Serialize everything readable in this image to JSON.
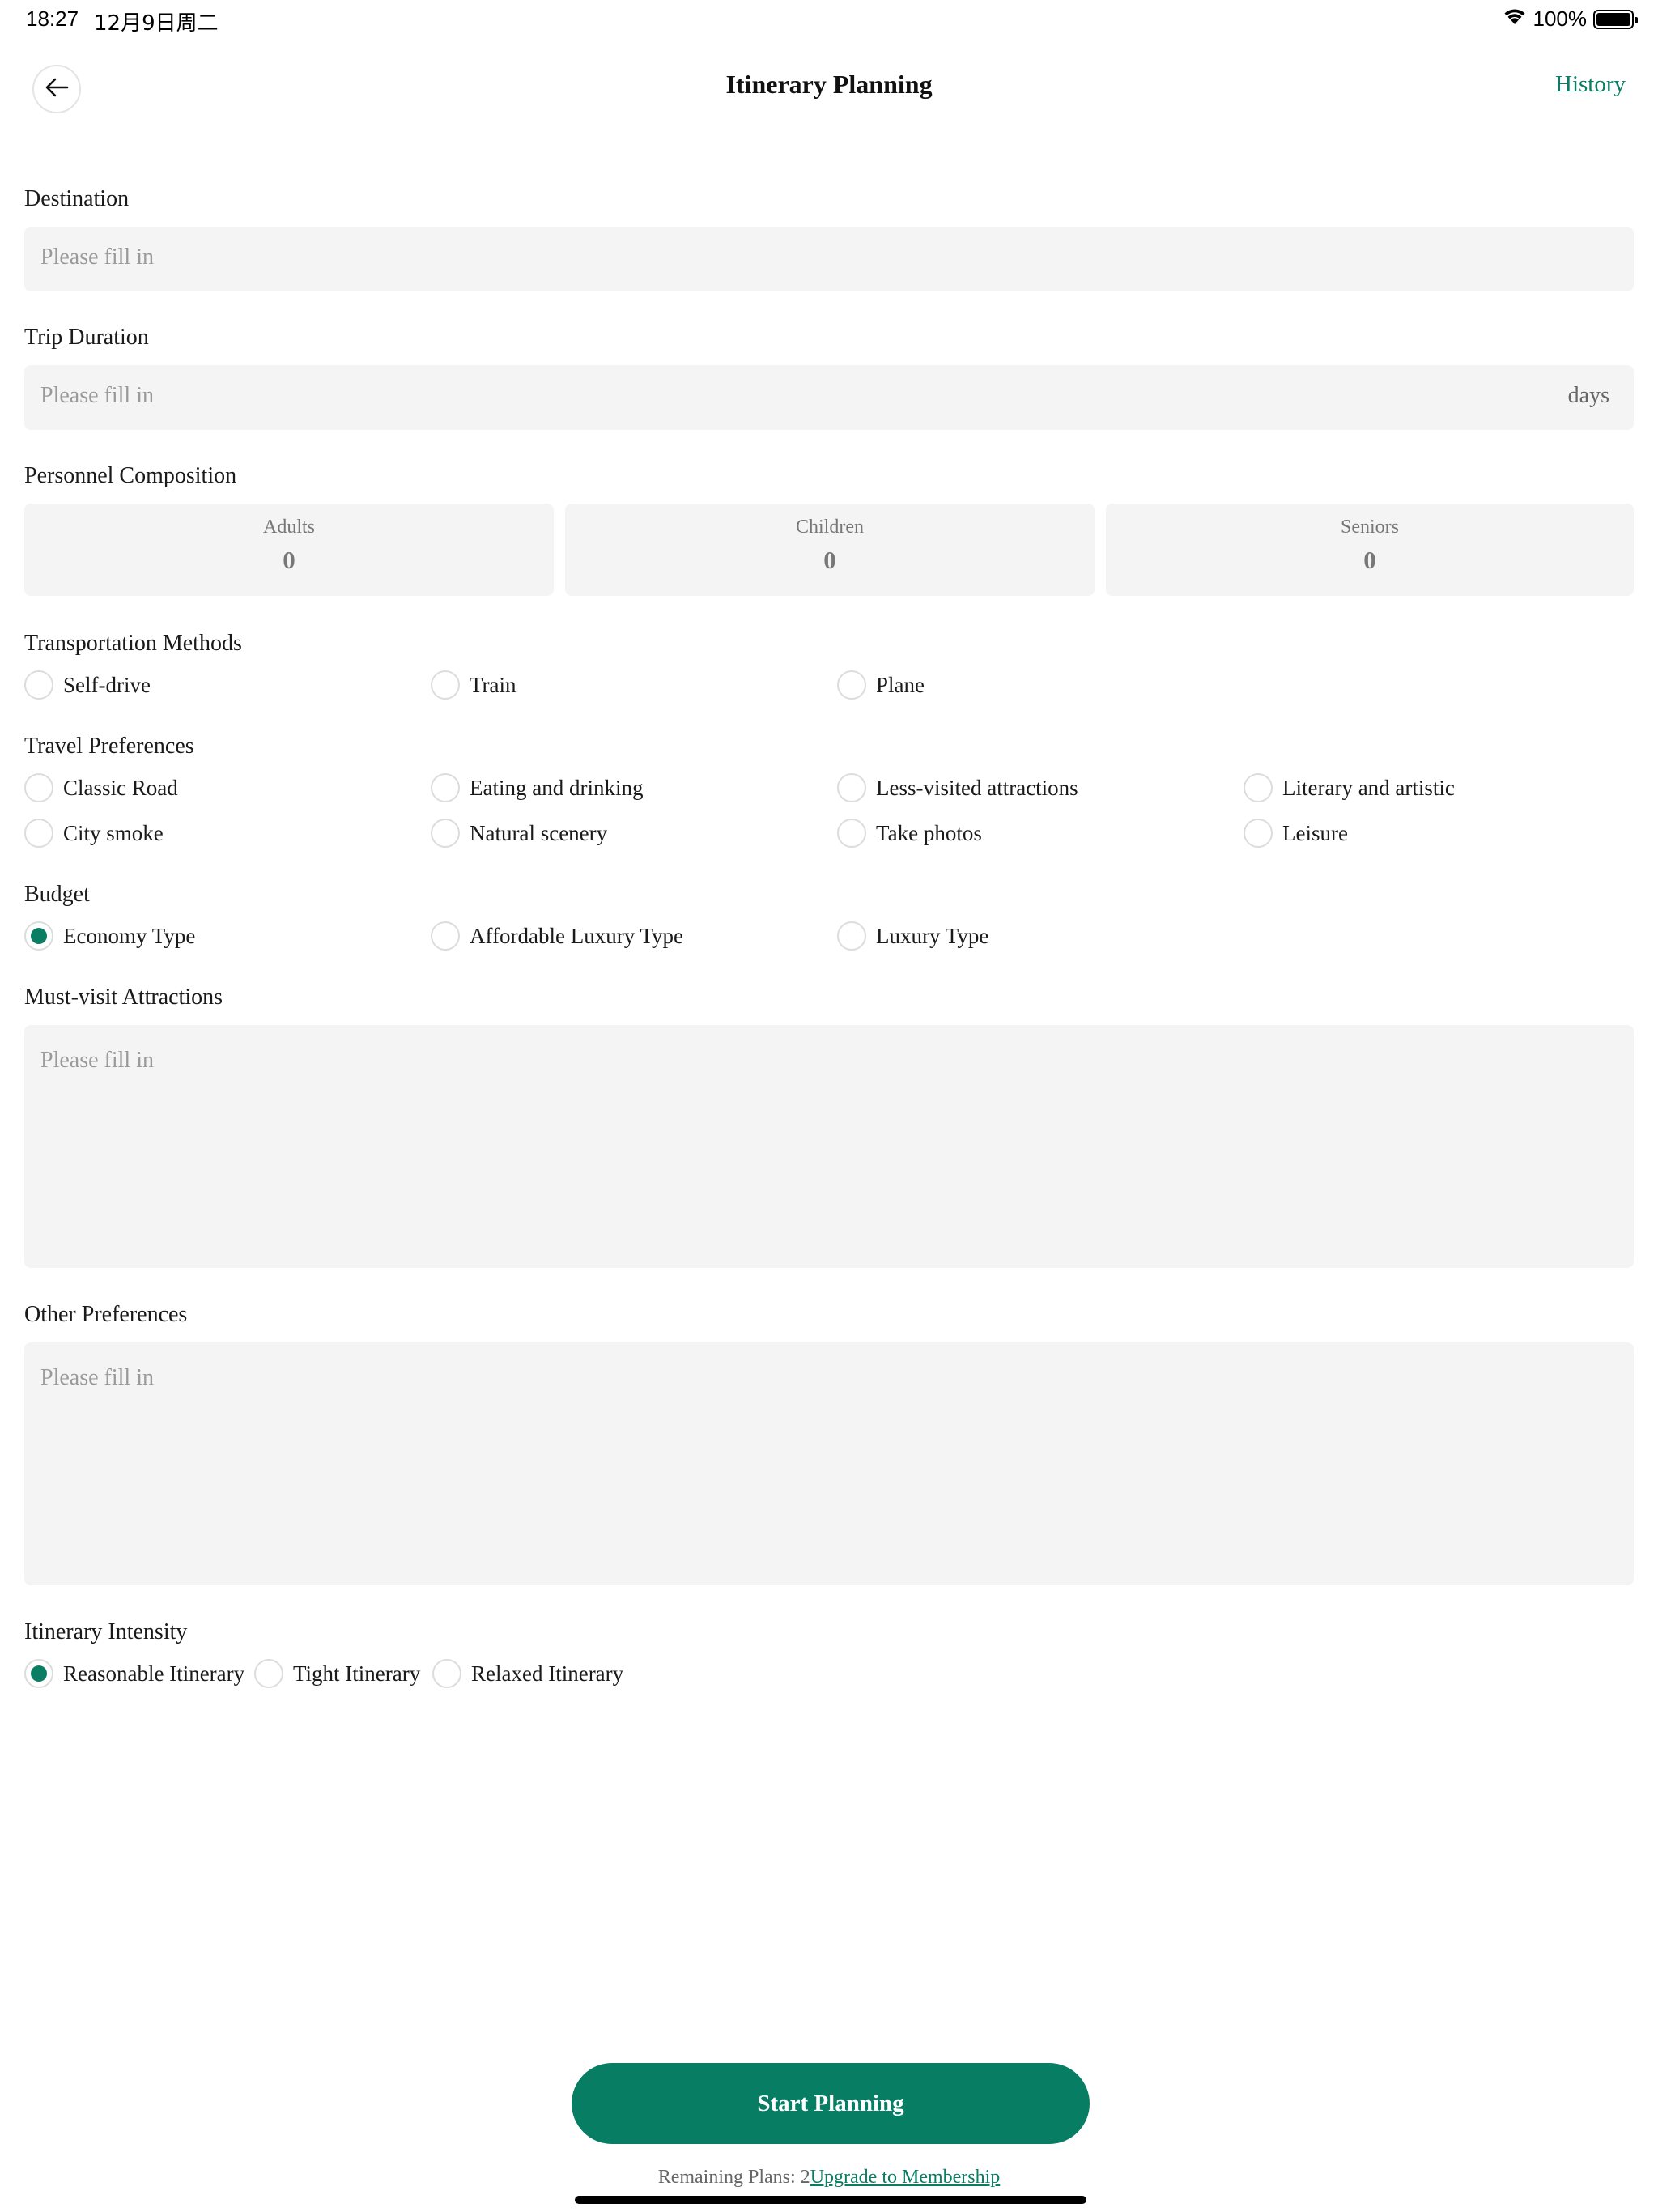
{
  "status_bar": {
    "time": "18:27",
    "date": "12月9日周二",
    "battery": "100%"
  },
  "header": {
    "title": "Itinerary Planning",
    "history_label": "History"
  },
  "destination": {
    "label": "Destination",
    "placeholder": "Please fill in"
  },
  "trip_duration": {
    "label": "Trip Duration",
    "placeholder": "Please fill in",
    "unit": "days"
  },
  "personnel": {
    "label": "Personnel Composition",
    "groups": [
      {
        "label": "Adults",
        "count": "0"
      },
      {
        "label": "Children",
        "count": "0"
      },
      {
        "label": "Seniors",
        "count": "0"
      }
    ]
  },
  "transportation": {
    "label": "Transportation Methods",
    "options": [
      {
        "label": "Self-drive",
        "selected": false
      },
      {
        "label": "Train",
        "selected": false
      },
      {
        "label": "Plane",
        "selected": false
      }
    ]
  },
  "travel_preferences": {
    "label": "Travel Preferences",
    "options": [
      {
        "label": "Classic Road",
        "selected": false
      },
      {
        "label": "Eating and drinking",
        "selected": false
      },
      {
        "label": "Less-visited attractions",
        "selected": false
      },
      {
        "label": "Literary and artistic",
        "selected": false
      },
      {
        "label": "City smoke",
        "selected": false
      },
      {
        "label": "Natural scenery",
        "selected": false
      },
      {
        "label": "Take photos",
        "selected": false
      },
      {
        "label": "Leisure",
        "selected": false
      }
    ]
  },
  "budget": {
    "label": "Budget",
    "options": [
      {
        "label": "Economy Type",
        "selected": true
      },
      {
        "label": "Affordable Luxury Type",
        "selected": false
      },
      {
        "label": "Luxury Type",
        "selected": false
      }
    ]
  },
  "must_visit": {
    "label": "Must-visit Attractions",
    "placeholder": "Please fill in"
  },
  "other_preferences": {
    "label": "Other Preferences",
    "placeholder": "Please fill in"
  },
  "intensity": {
    "label": "Itinerary Intensity",
    "options": [
      {
        "label": "Reasonable Itinerary",
        "selected": true
      },
      {
        "label": "Tight Itinerary",
        "selected": false
      },
      {
        "label": "Relaxed Itinerary",
        "selected": false
      }
    ]
  },
  "footer": {
    "start_label": "Start Planning",
    "remaining_text": "Remaining Plans: 2",
    "upgrade_label": "Upgrade to Membership"
  },
  "colors": {
    "accent": "#077d63",
    "input_bg": "#f4f4f4",
    "placeholder": "#9a9a9a"
  }
}
